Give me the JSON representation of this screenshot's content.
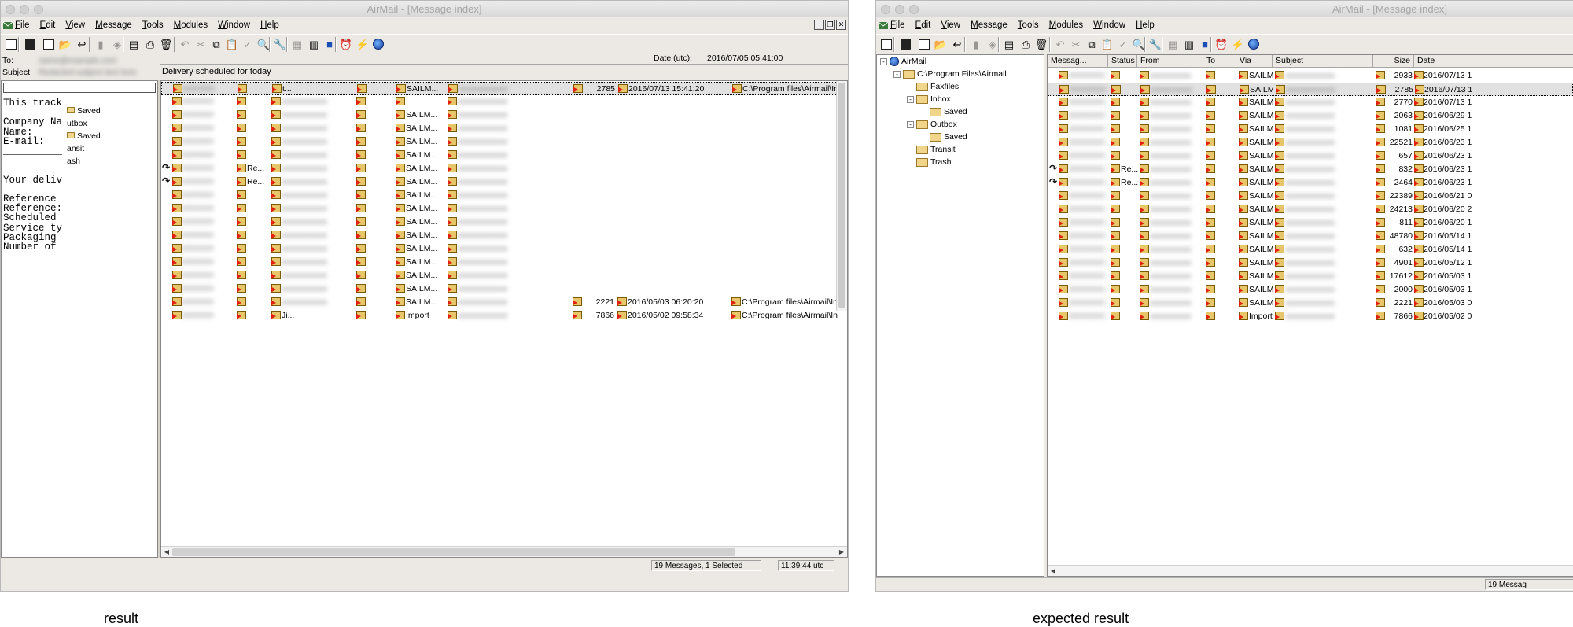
{
  "captions": {
    "left": "result",
    "right": "expected  result"
  },
  "app": {
    "title": "AirMail - [Message index]"
  },
  "menu": [
    "File",
    "Edit",
    "View",
    "Message",
    "Tools",
    "Modules",
    "Window",
    "Help"
  ],
  "toolbar_icons": [
    "layout-icon",
    "address-book-icon",
    "new-message-icon",
    "open-folder-icon",
    "reply-icon",
    "archive-icon",
    "attach-icon",
    "print-preview-icon",
    "print-icon",
    "delete-icon",
    "undo-icon",
    "cut-icon",
    "copy-icon",
    "paste-icon",
    "spellcheck-icon",
    "find-icon",
    "settings-icon",
    "view-list-icon",
    "view-detail-icon",
    "view-preview-icon",
    "schedule-icon",
    "lightning-icon",
    "globe-icon"
  ],
  "left_window": {
    "header": {
      "to_label": "To:",
      "subject_label": "Subject:",
      "date_label": "Date (utc):",
      "date_value": "2016/07/05 05:41:00",
      "to_value": "name@example.com",
      "subject_value": "Redacted subject text here"
    },
    "scheduled_banner": "Delivery scheduled for today",
    "body_lines": [
      "This track",
      "",
      "Company Na",
      "Name:",
      "E-mail:",
      "__________",
      "",
      "",
      "Your deliv",
      "",
      "Reference",
      "Reference:",
      "Scheduled",
      "Service ty",
      "Packaging",
      "Number of"
    ],
    "tree_overlay": [
      "Saved",
      "utbox",
      "Saved",
      "ansit",
      "ash"
    ],
    "rows": [
      {
        "status": "",
        "from": "t...",
        "via": "SAILM...",
        "size": "2785",
        "date": "2016/07/13 15:41:20",
        "path": "C:\\Program files\\Airmail\\In",
        "selected": true
      },
      {
        "status": "",
        "from": "",
        "via": "",
        "size": "",
        "date": "",
        "path": ""
      },
      {
        "status": "",
        "from": "",
        "via": "SAILM...",
        "size": "",
        "date": "",
        "path": ""
      },
      {
        "status": "",
        "from": "",
        "via": "SAILM...",
        "size": "",
        "date": "",
        "path": ""
      },
      {
        "status": "",
        "from": "",
        "via": "SAILM...",
        "size": "",
        "date": "",
        "path": ""
      },
      {
        "status": "",
        "from": "",
        "via": "SAILM...",
        "size": "",
        "date": "",
        "path": ""
      },
      {
        "status": "Re...",
        "from": "",
        "via": "SAILM...",
        "size": "",
        "date": "",
        "path": "",
        "reply": true
      },
      {
        "status": "Re...",
        "from": "",
        "via": "SAILM...",
        "size": "",
        "date": "",
        "path": "",
        "reply": true
      },
      {
        "status": "",
        "from": "",
        "via": "SAILM...",
        "size": "",
        "date": "",
        "path": ""
      },
      {
        "status": "",
        "from": "",
        "via": "SAILM...",
        "size": "",
        "date": "",
        "path": ""
      },
      {
        "status": "",
        "from": "",
        "via": "SAILM...",
        "size": "",
        "date": "",
        "path": ""
      },
      {
        "status": "",
        "from": "",
        "via": "SAILM...",
        "size": "",
        "date": "",
        "path": ""
      },
      {
        "status": "",
        "from": "",
        "via": "SAILM...",
        "size": "",
        "date": "",
        "path": ""
      },
      {
        "status": "",
        "from": "",
        "via": "SAILM...",
        "size": "",
        "date": "",
        "path": ""
      },
      {
        "status": "",
        "from": "",
        "via": "SAILM...",
        "size": "",
        "date": "",
        "path": ""
      },
      {
        "status": "",
        "from": "",
        "via": "SAILM...",
        "size": "",
        "date": "",
        "path": ""
      },
      {
        "status": "",
        "from": "",
        "via": "SAILM...",
        "size": "2221",
        "date": "2016/05/03 06:20:20",
        "path": "C:\\Program files\\Airmail\\In"
      },
      {
        "status": "",
        "from": "Ji...",
        "via": "Import",
        "size": "7866",
        "date": "2016/05/02 09:58:34",
        "path": "C:\\Program files\\Airmail\\In"
      }
    ],
    "status": {
      "messages": "19 Messages, 1 Selected",
      "time": "11:39:44 utc"
    }
  },
  "right_window": {
    "tree": [
      {
        "label": "AirMail",
        "level": 0,
        "expander": "-",
        "kind": "globe"
      },
      {
        "label": "C:\\Program Files\\Airmail",
        "level": 1,
        "expander": "-",
        "kind": "folder"
      },
      {
        "label": "Faxfiles",
        "level": 2,
        "expander": "",
        "kind": "folder"
      },
      {
        "label": "Inbox",
        "level": 2,
        "expander": "-",
        "kind": "folder"
      },
      {
        "label": "Saved",
        "level": 3,
        "expander": "",
        "kind": "folder"
      },
      {
        "label": "Outbox",
        "level": 2,
        "expander": "-",
        "kind": "folder"
      },
      {
        "label": "Saved",
        "level": 3,
        "expander": "",
        "kind": "folder"
      },
      {
        "label": "Transit",
        "level": 2,
        "expander": "",
        "kind": "folder"
      },
      {
        "label": "Trash",
        "level": 2,
        "expander": "",
        "kind": "folder"
      }
    ],
    "columns": [
      "Messag...",
      "Status",
      "From",
      "To",
      "Via",
      "Subject",
      "Size",
      "Date"
    ],
    "rows": [
      {
        "status": "",
        "via": "SAILM...",
        "size": "2933",
        "date": "2016/07/13 1"
      },
      {
        "status": "",
        "via": "SAILM...",
        "size": "2785",
        "date": "2016/07/13 1",
        "selected": true
      },
      {
        "status": "",
        "via": "SAILM...",
        "size": "2770",
        "date": "2016/07/13 1"
      },
      {
        "status": "",
        "via": "SAILM...",
        "size": "2063",
        "date": "2016/06/29 1"
      },
      {
        "status": "",
        "via": "SAILM...",
        "size": "1081",
        "date": "2016/06/25 1"
      },
      {
        "status": "",
        "via": "SAILM...",
        "size": "22521",
        "date": "2016/06/23 1"
      },
      {
        "status": "",
        "via": "SAILM...",
        "size": "657",
        "date": "2016/06/23 1"
      },
      {
        "status": "Re...",
        "via": "SAILM...",
        "size": "832",
        "date": "2016/06/23 1",
        "reply": true
      },
      {
        "status": "Re...",
        "via": "SAILM...",
        "size": "2464",
        "date": "2016/06/23 1",
        "reply": true
      },
      {
        "status": "",
        "via": "SAILM...",
        "size": "22389",
        "date": "2016/06/21 0"
      },
      {
        "status": "",
        "via": "SAILM...",
        "size": "24213",
        "date": "2016/06/20 2"
      },
      {
        "status": "",
        "via": "SAILM...",
        "size": "811",
        "date": "2016/06/20 1"
      },
      {
        "status": "",
        "via": "SAILM...",
        "size": "48780",
        "date": "2016/05/14 1"
      },
      {
        "status": "",
        "via": "SAILM...",
        "size": "632",
        "date": "2016/05/14 1"
      },
      {
        "status": "",
        "via": "SAILM...",
        "size": "4901",
        "date": "2016/05/12 1"
      },
      {
        "status": "",
        "via": "SAILM...",
        "size": "17612",
        "date": "2016/05/03 1"
      },
      {
        "status": "",
        "via": "SAILM...",
        "size": "2000",
        "date": "2016/05/03 1"
      },
      {
        "status": "",
        "via": "SAILM...",
        "size": "2221",
        "date": "2016/05/03 0"
      },
      {
        "status": "",
        "via": "Import",
        "size": "7866",
        "date": "2016/05/02 0"
      }
    ],
    "status": {
      "messages": "19 Messag"
    }
  }
}
